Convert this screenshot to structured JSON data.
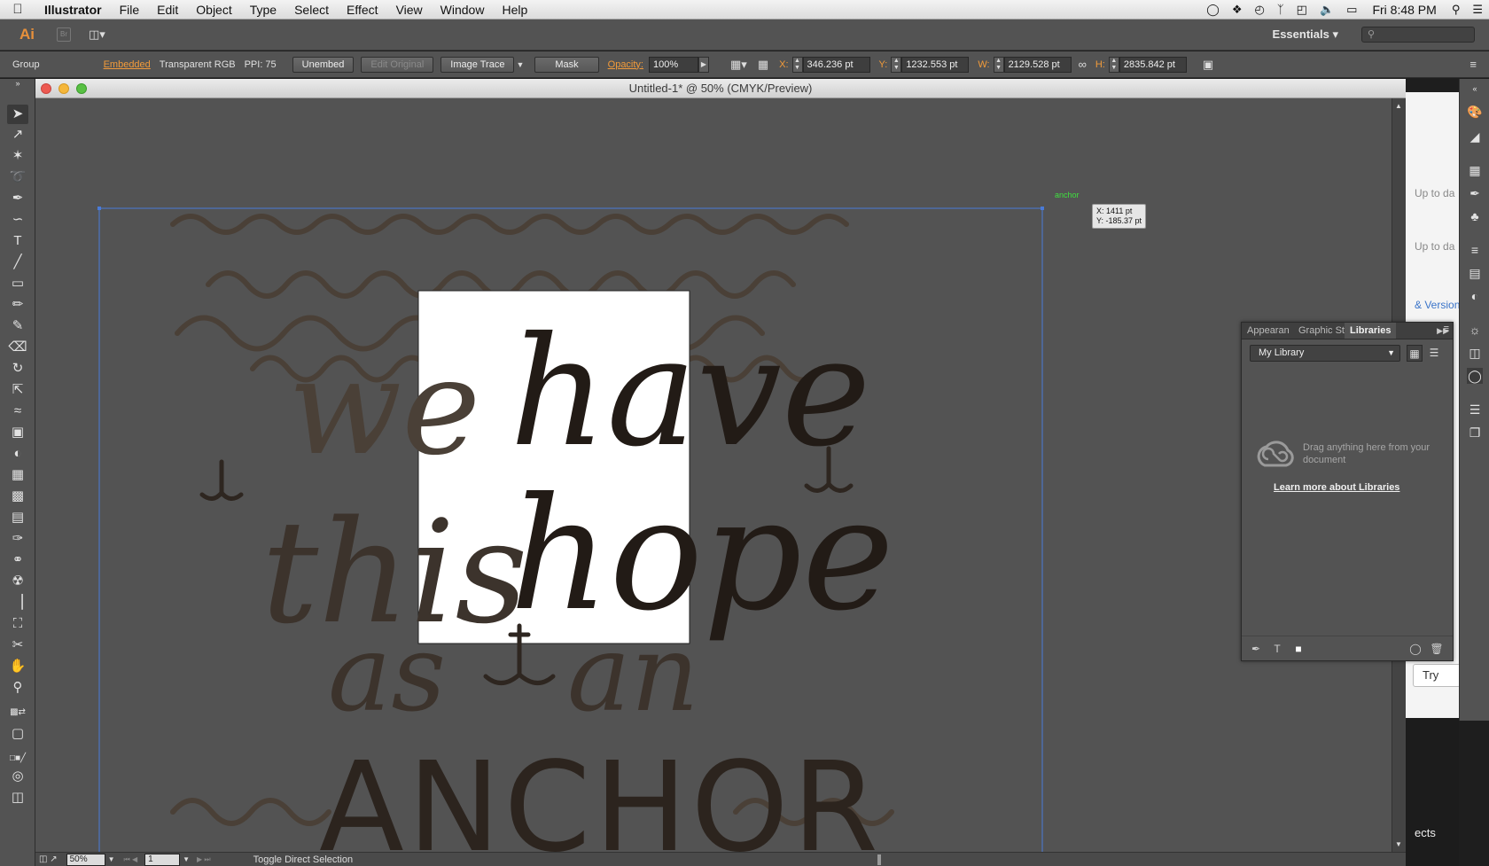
{
  "menubar": {
    "app_name": "Illustrator",
    "items": [
      "File",
      "Edit",
      "Object",
      "Type",
      "Select",
      "Effect",
      "View",
      "Window",
      "Help"
    ],
    "clock": "Fri 8:48 PM"
  },
  "appbar": {
    "ai_logo": "Ai",
    "bridge_logo": "Br",
    "workspace": "Essentials"
  },
  "control": {
    "selection_type": "Group",
    "embedded": "Embedded",
    "color_mode": "Transparent RGB",
    "ppi": "PPI: 75",
    "unembed": "Unembed",
    "edit_original": "Edit Original",
    "image_trace": "Image Trace",
    "mask": "Mask",
    "opacity_label": "Opacity:",
    "opacity_value": "100%",
    "x_label": "X:",
    "x_value": "346.236 pt",
    "y_label": "Y:",
    "y_value": "1232.553 pt",
    "w_label": "W:",
    "w_value": "2129.528 pt",
    "h_label": "H:",
    "h_value": "2835.842 pt"
  },
  "document": {
    "title": "Untitled-1* @ 50% (CMYK/Preview)",
    "smart_guide_label": "anchor",
    "tooltip_x": "X: 1411 pt",
    "tooltip_y": "Y: -185.37 pt",
    "art_words": [
      "we",
      "have",
      "this",
      "hope",
      "as",
      "an",
      "ANCHOR"
    ]
  },
  "statusbar": {
    "zoom": "50%",
    "artboard": "1",
    "status_text": "Toggle Direct Selection"
  },
  "libraries": {
    "tabs": [
      "Appearan",
      "Graphic St",
      "Libraries"
    ],
    "active_tab": "Libraries",
    "library_name": "My Library",
    "drag_text": "Drag anything here from your document",
    "learn_link": "Learn more about Libraries"
  },
  "background_window": {
    "line1": "Up to da",
    "line2": "Up to da",
    "link": "& Versions",
    "try_button": "Try",
    "desktop_text": "ects"
  },
  "colors": {
    "ui_panel": "#535353",
    "accent_orange": "#f29b3a",
    "selection_blue": "#4a7bd8",
    "smart_guide_green": "#3fe03f"
  }
}
